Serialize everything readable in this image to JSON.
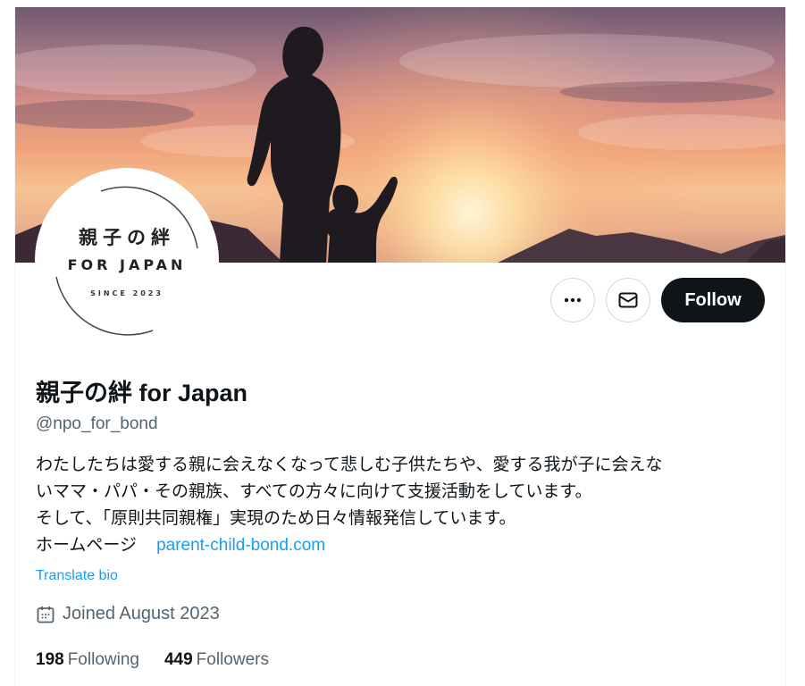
{
  "profile": {
    "display_name": "親子の絆 for Japan",
    "handle": "@npo_for_bond",
    "bio_lines": [
      "わたしたちは愛する親に会えなくなって悲しむ子供たちや、愛する我が子に会えな",
      "いママ・パパ・その親族、すべての方々に向けて支援活動をしています。",
      "そして、「原則共同親権」実現のため日々情報発信しています。"
    ],
    "homepage_label": "ホームページ",
    "homepage_link": "parent-child-bond.com",
    "translate_label": "Translate bio",
    "joined_text": "Joined August 2023",
    "following_count": "198",
    "following_label": "Following",
    "followers_count": "449",
    "followers_label": "Followers"
  },
  "avatar": {
    "title_jp": "親子の絆",
    "title_en": "FOR JAPAN",
    "since": "SINCE 2023"
  },
  "actions": {
    "more_icon": "more-horizontal-icon",
    "message_icon": "envelope-icon",
    "follow_label": "Follow"
  },
  "colors": {
    "accent": "#1d9bf0",
    "follow_bg": "#0f1419",
    "secondary_text": "#536471"
  }
}
